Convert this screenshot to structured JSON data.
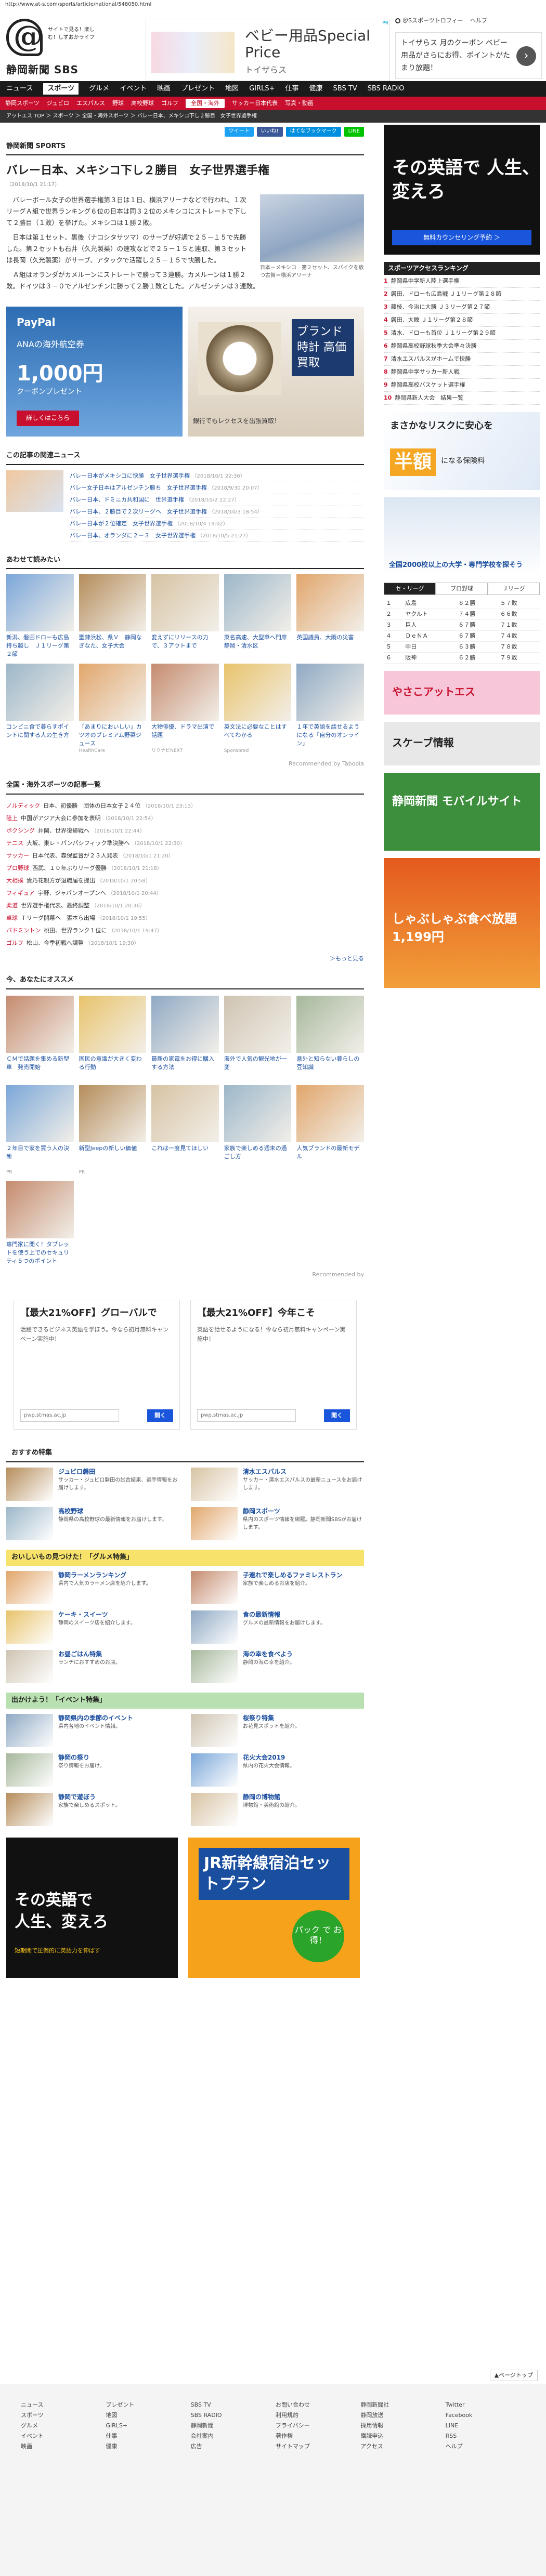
{
  "url": "http://www.at-s.com/sports/article/national/548050.html",
  "header": {
    "logo_sub": "サイトで見る！楽しむ！しずおかライフ",
    "paper": "静岡新聞 SBS",
    "ad_title": "ベビー用品Special Price",
    "ad_shop": "トイザらス",
    "ad_tag": "PR",
    "links": [
      "＠Sスポーツトロフィー",
      "ヘルプ"
    ],
    "promo": "トイザらス 月のクーポン ベビー用品がさらにお得、ポイントがたまり放題！",
    "promo_go": "›"
  },
  "nav": [
    "ニュース",
    "スポーツ",
    "グルメ",
    "イベント",
    "映画",
    "プレゼント",
    "地図",
    "GIRLS+",
    "仕事",
    "健康",
    "SBS TV",
    "SBS RADIO"
  ],
  "nav_active": "スポーツ",
  "subnav": [
    "静岡スポーツ",
    "ジュビロ",
    "エスパルス",
    "野球",
    "高校野球",
    "ゴルフ",
    "全国・海外",
    "サッカー日本代表",
    "写真・動画"
  ],
  "subnav_active": "全国・海外",
  "breadcrumb": "アットエス TOP ＞ スポーツ ＞ 全国・海外スポーツ ＞ バレー日本、メキシコ下し２勝目　女子世界選手権",
  "share": [
    "ツイート",
    "いいね!",
    "はてなブックマーク",
    "LINE"
  ],
  "section_label": "静岡新聞 SPORTS",
  "article": {
    "title": "バレー日本、メキシコ下し２勝目　女子世界選手権",
    "date": "（2018/10/1 21:17）",
    "paragraphs": [
      "バレーボール女子の世界選手権第３日は１日、横浜アリーナなどで行われ、１次リーグＡ組で世界ランキング６位の日本は同３２位のメキシコにストレートで下して２勝目（１敗）を挙げた。メキシコは１勝２敗。",
      "日本は第１セット、黒後（ナコシタサツマ）のサーブが好調で２５－１５で先勝した。第２セットも石井（久光製薬）の速攻などで２５－１５と連取、第３セットは長岡（久光製薬）がサーブ、アタックで活躍し２５－１５で快勝した。",
      "Ａ組はオランダがカメルーンにストレートで勝って３連勝。カメルーンは１勝２敗。ドイツは３－０でアルゼンチンに勝って２勝１敗とした。アルゼンチンは３連敗。"
    ],
    "photo_caption": "日本－メキシコ　第２セット、スパイクを放つ古賀＝横浜アリーナ"
  },
  "ads_mid": {
    "left_brand": "PayPal",
    "left_line": "ANAの海外航空券",
    "left_num": "1,000円",
    "left_sub": "クーポンプレゼント",
    "left_btn": "詳しくはこちら",
    "right_title": "ブランド時計 高価買取",
    "right_text": "銀行でもレクセスを出張買取！"
  },
  "related": {
    "title": "この記事の関連ニュース",
    "items": [
      {
        "t": "バレー日本がメキシコに快勝　女子世界選手権",
        "d": "（2018/10/1 22:36）"
      },
      {
        "t": "バレー女子日本はアルゼンチン勝ち　女子世界選手権",
        "d": "（2018/9/30 20:07）"
      },
      {
        "t": "バレー日本、ドミニカ共和国に　世界選手権",
        "d": "（2018/10/2 22:27）"
      },
      {
        "t": "バレー日本、２勝目で２次リーグへ　女子世界選手権",
        "d": "（2018/10/3 18:54）"
      },
      {
        "t": "バレー日本が２位確定　女子世界選手権",
        "d": "（2018/10/4 19:02）"
      },
      {
        "t": "バレー日本、オランダに２－３　女子世界選手権",
        "d": "（2018/10/5 21:27）"
      }
    ]
  },
  "also": {
    "title": "あわせて読みたい",
    "row1": [
      {
        "t": "新潟、磐田ドローも広島持ち越し　Ｊ１リーグ第２節",
        "s": ""
      },
      {
        "t": "聖隷浜松、県Ｖ　静岡なぎなた、女子大会",
        "s": ""
      },
      {
        "t": "変えずにリリースの力で、３アウトまで",
        "s": ""
      },
      {
        "t": "東名高速、大型車へ門扉　静岡・清水区",
        "s": ""
      },
      {
        "t": "英国議員、大雨の災害",
        "s": ""
      }
    ],
    "row2": [
      {
        "t": "コンビニ食で暮らすポイントに関する人の生き方",
        "s": ""
      },
      {
        "t": "「あまりにおいしい」カツオのプレミアム野菜ジュース",
        "s": "HealthCare"
      },
      {
        "t": "大物俳優、ドラマ出演で話題",
        "s": "リクナビNEXT"
      },
      {
        "t": "英文法に必要なことはすべてわかる",
        "s": "Sponsored"
      },
      {
        "t": "１年で英語を話せるようになる「自分のオンライン」",
        "s": ""
      }
    ],
    "credit": "Recommended by Taboola"
  },
  "national": {
    "title": "全国・海外スポーツの記事一覧",
    "items": [
      {
        "c": "ノルディック",
        "t": "日本、初優勝　団体の日本女子２４位",
        "d": "（2018/10/1 23:13）"
      },
      {
        "c": "陸上",
        "t": "中国がアジア大会に参加を表明",
        "d": "（2018/10/1 22:54）"
      },
      {
        "c": "ボクシング",
        "t": "井岡、世界復帰戦へ",
        "d": "（2018/10/1 22:44）"
      },
      {
        "c": "テニス",
        "t": "大坂、東レ・パンパシフィック準決勝へ",
        "d": "（2018/10/1 22:30）"
      },
      {
        "c": "サッカー",
        "t": "日本代表、森保監督が２３人発表",
        "d": "（2018/10/1 21:20）"
      },
      {
        "c": "プロ野球",
        "t": "西武、１０年ぶりリーグ優勝",
        "d": "（2018/10/1 21:18）"
      },
      {
        "c": "大相撲",
        "t": "貴乃花親方が退職届を提出",
        "d": "（2018/10/1 20:58）"
      },
      {
        "c": "フィギュア",
        "t": "宇野、ジャパンオープンへ",
        "d": "（2018/10/1 20:44）"
      },
      {
        "c": "柔道",
        "t": "世界選手権代表、最終調整",
        "d": "（2018/10/1 20:36）"
      },
      {
        "c": "卓球",
        "t": "Ｔリーグ開幕へ　張本ら出場",
        "d": "（2018/10/1 19:55）"
      },
      {
        "c": "バドミントン",
        "t": "桃田、世界ランク１位に",
        "d": "（2018/10/1 19:47）"
      },
      {
        "c": "ゴルフ",
        "t": "松山、今季初戦へ調整",
        "d": "（2018/10/1 19:30）"
      }
    ],
    "more": "＞もっと見る"
  },
  "reco": {
    "title": "今、あなたにオススメ",
    "items": [
      {
        "t": "ＣＭで話題を集める新型車　発売開始",
        "s": ""
      },
      {
        "t": "国民の意識が大きく変わる行動",
        "s": ""
      },
      {
        "t": "最新の家電をお得に購入する方法",
        "s": ""
      },
      {
        "t": "海外で人気の観光地が一変",
        "s": ""
      },
      {
        "t": "意外と知らない暮らしの豆知識",
        "s": ""
      },
      {
        "t": "２年目で家を買う人の決断",
        "s": "PR"
      },
      {
        "t": "新型Jeepの新しい価値",
        "s": "PR"
      },
      {
        "t": "これは一度見てほしい",
        "s": ""
      },
      {
        "t": "家族で楽しめる週末の過ごし方",
        "s": ""
      },
      {
        "t": "人気ブランドの最新モデル",
        "s": ""
      },
      {
        "t": "専門家に聞く！タブレットを使う上でのセキュリティ５つのポイント",
        "s": ""
      }
    ],
    "credit": "Recommended by"
  },
  "adx": [
    {
      "h": "【最大21%OFF】グローバルで",
      "p": "活躍できるビジネス英語を学ぼう。今なら初月無料キャンペーン実施中！",
      "u": "pwp.stmas.ac.jp",
      "b": "開く"
    },
    {
      "h": "【最大21%OFF】今年こそ",
      "p": "英語を話せるようになる！今なら初月無料キャンペーン実施中！",
      "u": "pwp.stmas.ac.jp",
      "b": "開く"
    }
  ],
  "osusume": {
    "title": "おすすめ特集",
    "items": [
      {
        "t": "ジュビロ磐田",
        "d": "サッカー・ジュビロ磐田の試合結果、選手情報をお届けします。"
      },
      {
        "t": "清水エスパルス",
        "d": "サッカー・清水エスパルスの最新ニュースをお届けします。"
      },
      {
        "t": "高校野球",
        "d": "静岡県の高校野球の最新情報をお届けします。"
      },
      {
        "t": "静岡スポーツ",
        "d": "県内のスポーツ情報を網羅。静岡新聞SBSがお届けします。"
      }
    ]
  },
  "gourmet": {
    "title": "おいしいもの見つけた！「グルメ特集」",
    "items": [
      {
        "t": "静岡ラーメンランキング",
        "d": "県内で人気のラーメン店を紹介します。"
      },
      {
        "t": "子連れで楽しめるファミレストラン",
        "d": "家族で楽しめるお店を紹介。"
      },
      {
        "t": "ケーキ・スイーツ",
        "d": "静岡のスイーツ店を紹介します。"
      },
      {
        "t": "食の最新情報",
        "d": "グルメの最新情報をお届けします。"
      },
      {
        "t": "お昼ごはん特集",
        "d": "ランチにおすすめのお店。"
      },
      {
        "t": "海の幸を食べよう",
        "d": "静岡の海の幸を紹介。"
      }
    ]
  },
  "events": {
    "title": "出かけよう！「イベント特集」",
    "items": [
      {
        "t": "静岡県内の季節のイベント",
        "d": "県内各地のイベント情報。"
      },
      {
        "t": "桜祭り特集",
        "d": "お花見スポットを紹介。"
      },
      {
        "t": "静岡の祭り",
        "d": "祭り情報をお届け。"
      },
      {
        "t": "花火大会2019",
        "d": "県内の花火大会情報。"
      },
      {
        "t": "静岡で遊ぼう",
        "d": "家族で楽しめるスポット。"
      },
      {
        "t": "静岡の博物館",
        "d": "博物館・美術館の紹介。"
      }
    ]
  },
  "bigads": {
    "left_top": "その英語で 人生、変えろ",
    "left_sub": "短期間で圧倒的に英語力を伸ばす",
    "right_title": "JR新幹線宿泊セットプラン",
    "right_badge": "パック で お得！"
  },
  "side": {
    "ad1_title": "その英語で 人生、変えろ",
    "ad1_btn": "無料カウンセリング予約 ＞",
    "ranking_title": "スポーツアクセスランキング",
    "ranking": [
      "静岡県中学新人陸上選手権",
      "磐田、ドローも広島戦 Ｊ１リーグ第２８節",
      "藤枝、今治に大勝 Ｊ３リーグ第２７節",
      "磐田、大敗 Ｊ１リーグ第２８節",
      "清水、ドローも首位 Ｊ１リーグ第２９節",
      "静岡県高校野球秋季大会準々決勝",
      "清水エスパルスがホームで快勝",
      "静岡県中学サッカー新人戦",
      "静岡県高校バスケット選手権",
      "静岡県新人大会　結果一覧"
    ],
    "insurance": "まさかなリスクに安心を",
    "insurance_num": "半額",
    "insurance_sub": "になる保険料",
    "univ": "全国2000校以上の大学・専門学校を探そう",
    "tabs": [
      "セ・リーグ",
      "プロ野球",
      "Ｊリーグ"
    ],
    "standings": [
      [
        "１",
        "広島",
        "８２勝",
        "５７敗"
      ],
      [
        "２",
        "ヤクルト",
        "７４勝",
        "６６敗"
      ],
      [
        "３",
        "巨人",
        "６７勝",
        "７１敗"
      ],
      [
        "４",
        "ＤｅＮＡ",
        "６７勝",
        "７４敗"
      ],
      [
        "５",
        "中日",
        "６３勝",
        "７８敗"
      ],
      [
        "６",
        "阪神",
        "６２勝",
        "７９敗"
      ]
    ],
    "banners": [
      "やさこアットエス",
      "スケーブ情報",
      "静岡新聞 モバイルサイト",
      "しゃぶしゃぶ食べ放題 1,199円"
    ]
  },
  "footer": {
    "cols": [
      [
        "ニュース",
        "スポーツ",
        "グルメ",
        "イベント",
        "映画"
      ],
      [
        "プレゼント",
        "地図",
        "GIRLS+",
        "仕事",
        "健康"
      ],
      [
        "SBS TV",
        "SBS RADIO",
        "静岡新聞",
        "会社案内",
        "広告"
      ],
      [
        "お問い合わせ",
        "利用規約",
        "プライバシー",
        "著作権",
        "サイトマップ"
      ],
      [
        "静岡新聞社",
        "静岡放送",
        "採用情報",
        "購読申込",
        "アクセス"
      ],
      [
        "Twitter",
        "Facebook",
        "LINE",
        "RSS",
        "ヘルプ"
      ]
    ],
    "pagetop": "▲ページトップ"
  },
  "colors": {
    "nav": "#1a1a1a",
    "accent": "#c8102e"
  }
}
